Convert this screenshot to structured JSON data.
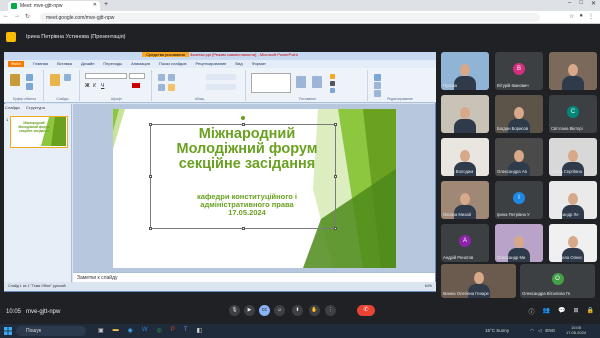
{
  "browser": {
    "tab_title": "Meet: mve-gjtt-npw",
    "new_tab": "+",
    "url": "meet.google.com/mve-gjtt-npw",
    "window_controls": [
      "–",
      "□",
      "✕"
    ]
  },
  "meet": {
    "presenter_label": "Ірина Петрівна Устинова (Презентація)",
    "time": "10:05",
    "meeting_code": "mve-gjtt-npw"
  },
  "powerpoint": {
    "title_left": "Средства рисования",
    "title_doc": "Зачетки.ppt [Режим совместимости] - Microsoft PowerPoint",
    "menu": [
      "Файл",
      "Главная",
      "Вставка",
      "Дизайн",
      "Переходы",
      "Анимация",
      "Показ слайдов",
      "Рецензирование",
      "Вид",
      "Формат"
    ],
    "ribbon_groups": [
      "Буфер обмена",
      "Слайды",
      "Шрифт",
      "Абзац",
      "Рисование",
      "Редактирование"
    ],
    "panel_tabs": [
      "Слайды",
      "Структура"
    ],
    "slide_number": "1",
    "notes_placeholder": "Заметки к слайду",
    "status_left": "Слайд 1 из 1   \"Тема Office\"   русский",
    "zoom": "64%"
  },
  "slide": {
    "title_lines": [
      "Міжнародний",
      "Молодіжний форум",
      "секційне засідання"
    ],
    "subtitle_lines": [
      "кафедри конституційного і",
      "адміністративного права",
      "17.05.2024"
    ],
    "accent_color": "#6aa121"
  },
  "participants": [
    {
      "name": "Пухова",
      "type": "video",
      "bg": "#8fb4d6"
    },
    {
      "name": "Вітурій Іванович",
      "type": "avatar",
      "letter": "В",
      "color": "#d32f7f"
    },
    {
      "name": "",
      "type": "video",
      "bg": "#7b6a5c"
    },
    {
      "name": "",
      "type": "video",
      "bg": "#c9c2b6"
    },
    {
      "name": "Богдан Борисов",
      "type": "video",
      "bg": "#5d5449"
    },
    {
      "name": "Світлана Вікторі",
      "type": "avatar",
      "letter": "С",
      "color": "#00897b"
    },
    {
      "name": "Антон Володим",
      "type": "video",
      "bg": "#e9e5df"
    },
    {
      "name": "Олександра Ав",
      "type": "video",
      "bg": "#4a4a4a"
    },
    {
      "name": "Ольга Сергіївна",
      "type": "video",
      "bg": "#d8d8d8"
    },
    {
      "name": "Оксана Михай",
      "type": "video",
      "bg": "#a08876"
    },
    {
      "name": "Ірина Петрівна У",
      "type": "avatar",
      "letter": "І",
      "color": "#1e88e5"
    },
    {
      "name": "Олександр Ле",
      "type": "video",
      "bg": "#eaeaea"
    },
    {
      "name": "Андрій Ренатов",
      "type": "avatar",
      "letter": "А",
      "color": "#8e24aa"
    },
    {
      "name": "Олександр Ми",
      "type": "video",
      "bg": "#b9a3c9"
    },
    {
      "name": "Людмила Олекс",
      "type": "video",
      "bg": "#f0f0f0"
    },
    {
      "name": "Іванна Олегівна Генаре",
      "type": "video",
      "bg": "#6b5a4e"
    },
    {
      "name": "Олександра Віталієва Ге",
      "type": "avatar",
      "letter": "О",
      "color": "#43a047"
    }
  ],
  "controls": [
    "mic-icon",
    "camera-icon",
    "captions-icon",
    "emoji-icon",
    "present-icon",
    "hand-icon",
    "more-icon"
  ],
  "end_call": "✆",
  "taskbar": {
    "search": "Пошук",
    "weather": "15°C  Sunny",
    "tray": "ENG",
    "time": "10:05",
    "date": "17.05.2024"
  }
}
